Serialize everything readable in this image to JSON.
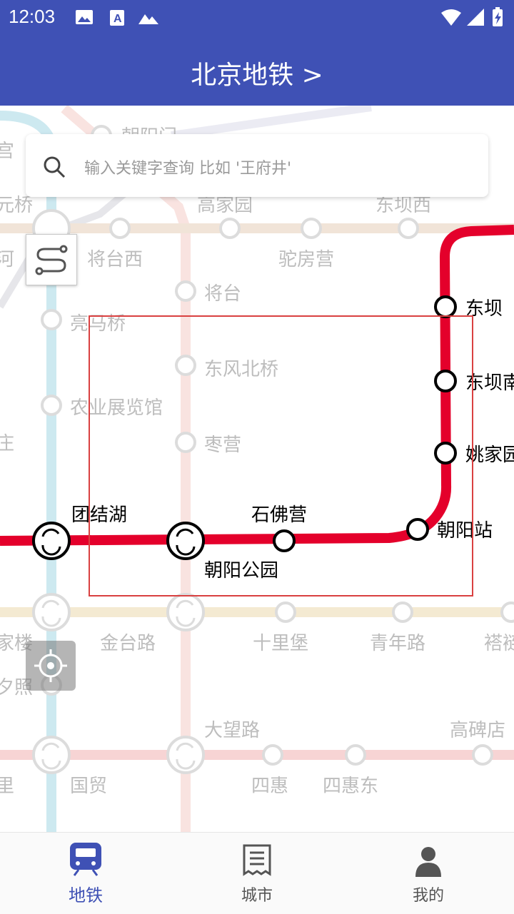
{
  "status": {
    "time": "12:03"
  },
  "header": {
    "title": "北京地铁 >"
  },
  "search": {
    "placeholder": "输入关键字查询 比如 '王府井'"
  },
  "colors": {
    "primary": "#3f51b5",
    "highlight_line": "#e4002b",
    "selection_box": "#d94040"
  },
  "icons": {
    "search": "search-icon",
    "route": "route-icon",
    "locate": "locate-icon",
    "transfer": "transfer-icon"
  },
  "map": {
    "labels": {
      "chaoyangmen": "朝阳门",
      "gong": "宫",
      "yuanqiao": "元桥",
      "gaojiayuan": "高家园",
      "dongbaxi": "东坝西",
      "jiangtaixi": "将台西",
      "tuofangying": "驼房营",
      "he": "河",
      "jiangtai": "将台",
      "liangmaqiao": "亮马桥",
      "dongfengbeiqiao": "东风北桥",
      "nongyezhanlanguan": "农业展览馆",
      "zhuang": "庄",
      "zaoying": "枣营",
      "jialou": "家楼",
      "jintailu": "金台路",
      "shilipu": "十里堡",
      "qingnianlu": "青年路",
      "xi": "褡裢",
      "xizhao": "夕照",
      "dawanglu": "大望路",
      "gaobeidian": "高碑店",
      "li": "里",
      "guomao": "国贸",
      "sihui": "四惠",
      "sihuidong": "四惠东"
    },
    "active_labels": {
      "dongba": "东坝",
      "dongbanan": "东坝南",
      "yaojiayuan": "姚家园",
      "tuanjiehu": "团结湖",
      "shifoying": "石佛营",
      "chaoyanggongyuan": "朝阳公园",
      "chaoyangzhan": "朝阳站"
    }
  },
  "nav": [
    {
      "label": "地铁",
      "icon": "subway-icon",
      "active": true
    },
    {
      "label": "城市",
      "icon": "city-list-icon",
      "active": false
    },
    {
      "label": "我的",
      "icon": "profile-icon",
      "active": false
    }
  ]
}
